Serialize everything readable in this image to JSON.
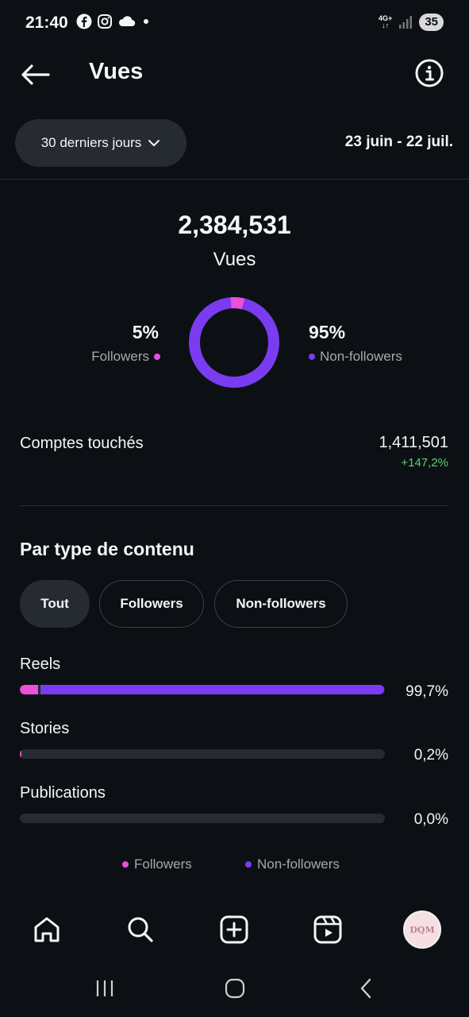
{
  "status_bar": {
    "time": "21:40",
    "network_top": "4G+",
    "network_bottom": "↓↑",
    "battery": "35"
  },
  "header": {
    "title": "Vues"
  },
  "range": {
    "selector_label": "30 derniers jours",
    "dates": "23 juin - 22 juil."
  },
  "summary": {
    "total": "2,384,531",
    "total_label": "Vues",
    "followers_pct": "5%",
    "followers_label": "Followers",
    "non_followers_pct": "95%",
    "non_followers_label": "Non-followers",
    "followers_share": 0.05
  },
  "accounts": {
    "label": "Comptes touchés",
    "value": "1,411,501",
    "change": "+147,2%"
  },
  "content_type": {
    "title": "Par type de contenu",
    "filters": [
      "Tout",
      "Followers",
      "Non-followers"
    ],
    "active_filter": "Tout",
    "rows": [
      {
        "label": "Reels",
        "value": "99,7%",
        "share": 0.997,
        "followers_share": 0.05
      },
      {
        "label": "Stories",
        "value": "0,2%",
        "share": 0.002,
        "followers_share": 1.0
      },
      {
        "label": "Publications",
        "value": "0,0%",
        "share": 0.0,
        "followers_share": 0
      }
    ],
    "legend": [
      "Followers",
      "Non-followers"
    ]
  },
  "colors": {
    "followers": "#ec4fd8",
    "non_followers": "#7a3cf0",
    "positive": "#5bd16a",
    "background": "#0c1014"
  },
  "nav": {
    "avatar_text": "DQM"
  }
}
